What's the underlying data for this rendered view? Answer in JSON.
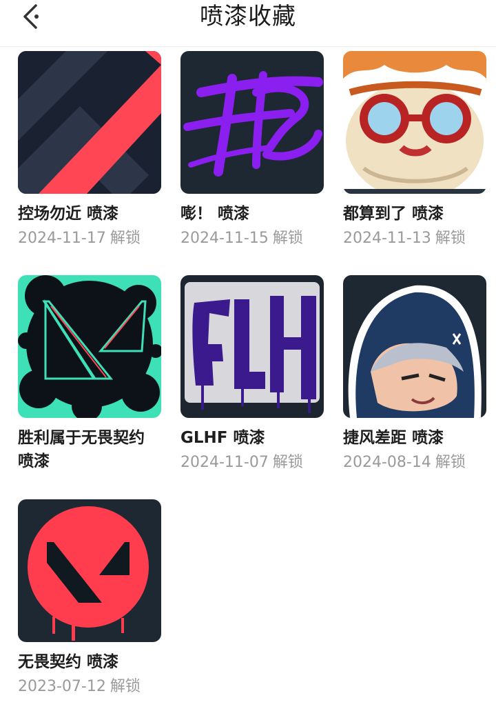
{
  "header": {
    "title": "喷漆收藏"
  },
  "sprays": [
    {
      "name": "控场勿近 喷漆",
      "date": "2024-11-17",
      "status": "解锁",
      "thumb_icon": "diagonal-chevron-spray"
    },
    {
      "name": "嘭！ 喷漆",
      "date": "2024-11-15",
      "status": "解锁",
      "thumb_icon": "purple-graffiti-spray"
    },
    {
      "name": "都算到了 喷漆",
      "date": "2024-11-13",
      "status": "解锁",
      "thumb_icon": "goggles-character-spray"
    },
    {
      "name": "胜利属于无畏契约 喷漆",
      "date": "",
      "status": "",
      "thumb_icon": "valorant-logo-splatter-spray"
    },
    {
      "name": "GLHF 喷漆",
      "date": "2024-11-07",
      "status": "解锁",
      "thumb_icon": "glhf-graffiti-spray"
    },
    {
      "name": "捷风差距 喷漆",
      "date": "2024-08-14",
      "status": "解锁",
      "thumb_icon": "hooded-agent-spray"
    },
    {
      "name": "无畏契约 喷漆",
      "date": "2023-07-12",
      "status": "解锁",
      "thumb_icon": "red-v-circle-spray"
    }
  ],
  "colors": {
    "accent_red": "#ff4655",
    "dark_bg": "#1b2631",
    "date_gray": "#9a9a9a"
  }
}
